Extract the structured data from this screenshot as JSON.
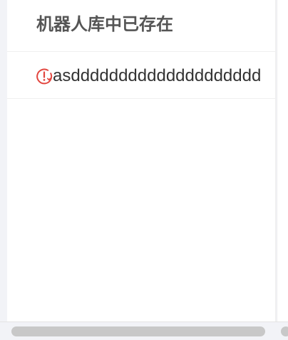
{
  "header": {
    "title": "机器人库中已存在"
  },
  "row": {
    "text": "asdddddddddddddddddddd",
    "icon": "alert-circle-icon"
  },
  "colors": {
    "error": "#e2463f",
    "text": "#333333",
    "header_text": "#555555",
    "background": "#f2f3f7",
    "scrollbar": "#c8c8c8"
  }
}
